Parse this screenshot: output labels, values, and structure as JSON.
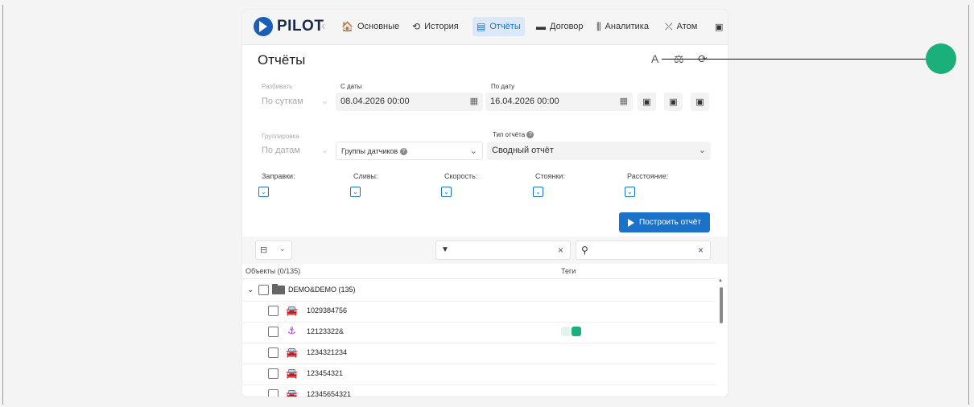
{
  "nav": {
    "logo_text": "PILOT",
    "back_glyph": "‹",
    "items": [
      {
        "label": "Основные",
        "icon": "home-icon",
        "glyph": "🏠"
      },
      {
        "label": "История",
        "icon": "history-icon",
        "glyph": "⟲"
      },
      {
        "label": "Отчёты",
        "icon": "report-icon",
        "glyph": "▤",
        "active": true
      },
      {
        "label": "Договор",
        "icon": "contract-icon",
        "glyph": "▬"
      },
      {
        "label": "Аналитика",
        "icon": "analytics-icon",
        "glyph": "⫼"
      },
      {
        "label": "Атом",
        "icon": "atom-icon",
        "glyph": "⤫"
      }
    ],
    "bus_glyph": "▣"
  },
  "page": {
    "title": "Отчёты",
    "header_icons": [
      {
        "name": "font-icon",
        "glyph": "A"
      },
      {
        "name": "scales-icon",
        "glyph": "⚖"
      },
      {
        "name": "refresh-icon",
        "glyph": "⟳"
      }
    ]
  },
  "form": {
    "split": {
      "label": "Разбивать",
      "value": "По суткам",
      "chev": "⌄"
    },
    "date_from": {
      "label": "С даты",
      "value": "08.04.2026 00:00",
      "icon_glyph": "▦"
    },
    "date_to": {
      "label": "По дату",
      "value": "16.04.2026 00:00",
      "icon_glyph": "▦"
    },
    "calendar_buttons": [
      "▣",
      "▣",
      "▣"
    ],
    "grouping": {
      "label": "Группировка",
      "value": "По датам",
      "chev": "⌄"
    },
    "sensor_groups": {
      "placeholder": "Группы датчиков",
      "help": "?",
      "chev": "⌄"
    },
    "report_type": {
      "label": "Тип отчёта",
      "help": "?",
      "value": "Сводный отчёт",
      "chev": "⌄"
    },
    "checks": [
      {
        "label": "Заправки:",
        "mark": "⌄"
      },
      {
        "label": "Сливы:",
        "mark": "⌄"
      },
      {
        "label": "Скорость:",
        "mark": "⌄"
      },
      {
        "label": "Стоянки:",
        "mark": "⌄"
      },
      {
        "label": "Расстояние:",
        "mark": "⌄"
      }
    ],
    "build_label": "Построить отчёт"
  },
  "toolbar": {
    "tree_glyph": "⊟",
    "tree_chev": "⌄",
    "filter_glyph": "▼",
    "clear_glyph": "×",
    "search_glyph": "⚲"
  },
  "table": {
    "columns": [
      "Объекты (0/135)",
      "Теги"
    ],
    "group": {
      "chev": "⌄",
      "name": "DEMO&DEMO (135)"
    },
    "rows": [
      {
        "name": "1029384756",
        "type": "car",
        "glyph": "🚘"
      },
      {
        "name": "12123322&",
        "type": "anchor",
        "glyph": "⚓",
        "tags": true
      },
      {
        "name": "1234321234",
        "type": "car",
        "glyph": "🚘"
      },
      {
        "name": "123454321",
        "type": "car",
        "glyph": "🚘"
      },
      {
        "name": "12345654321",
        "type": "car",
        "glyph": "🚘"
      }
    ]
  },
  "colors": {
    "accent": "#1a73c8",
    "active_bg": "#dbe8f8",
    "tag_green": "#1bb07a",
    "anchor_purple": "#a030d0"
  }
}
